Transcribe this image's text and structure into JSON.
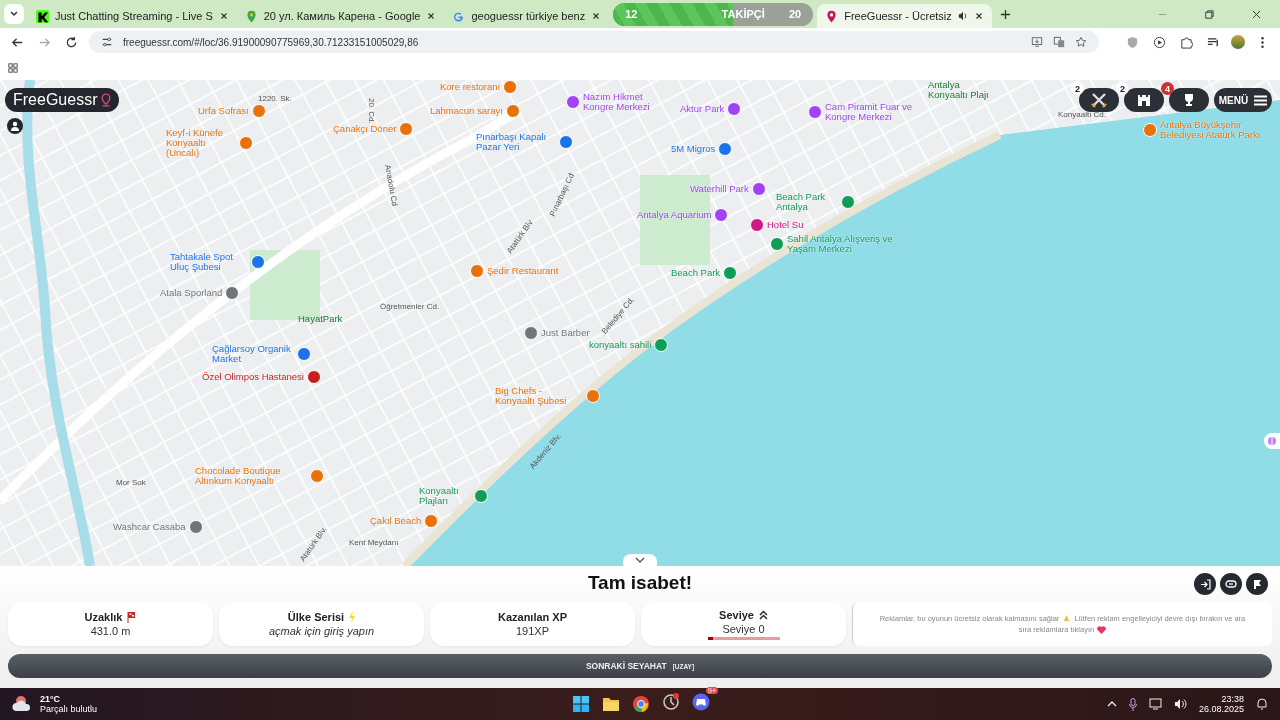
{
  "browser": {
    "tabs": [
      {
        "title": "Just Chatting Streaming - Live S",
        "selected": false
      },
      {
        "title": "20 ул. Камиль Карена - Google",
        "selected": false
      },
      {
        "title": "geoguessr türkiye benz",
        "selected": false
      },
      {
        "title": "FreeGuessr - Ücretsiz",
        "selected": true
      }
    ],
    "follower_goal": {
      "current": "12",
      "label": "TAKİPÇİ",
      "target": "20",
      "level": 0.6
    },
    "url": "freeguessr.com/#/loc/36.91900090775969,30.71233151005029,86"
  },
  "map": {
    "logo": "FreeGuessr",
    "buttons": [
      {
        "badge": "2",
        "color": "#ffffff"
      },
      {
        "badge": "2",
        "color": "#ffffff"
      },
      {
        "badge": "4",
        "color": "#d32f2f"
      }
    ],
    "menu_button": "MENÜ",
    "labels": [
      {
        "kind": "poi",
        "text": "Kore restoranı",
        "color": "#e8710a"
      },
      {
        "kind": "area",
        "text": "Antalya Konyaaltı Plajı"
      },
      {
        "kind": "poi",
        "text": "Urfa Sofrası",
        "color": "#e8710a"
      },
      {
        "kind": "street",
        "text": "1220. Sk."
      },
      {
        "kind": "street",
        "text": "20. Cd."
      },
      {
        "kind": "poi",
        "text": "Lahmacun sarayı",
        "color": "#e8710a"
      },
      {
        "kind": "poi",
        "text": "Nazım Hikmet Kongre Merkezi",
        "color": "#a142f4"
      },
      {
        "kind": "poi",
        "text": "Aktur Park",
        "color": "#a142f4"
      },
      {
        "kind": "poi",
        "text": "Cam Piramit Fuar ve Kongre Merkezi",
        "color": "#a142f4"
      },
      {
        "kind": "street",
        "text": "Konyaaltı Cd."
      },
      {
        "kind": "poi",
        "text": "Keyf-i Künefe Konyaaltı (Uncalı)",
        "color": "#e8710a"
      },
      {
        "kind": "poi",
        "text": "Çanakçı Döner",
        "color": "#e8710a"
      },
      {
        "kind": "poi",
        "text": "Pınarbaşı Kapalı Pazar Yeri",
        "color": "#1a73e8"
      },
      {
        "kind": "poi",
        "text": "5M Migros",
        "color": "#1a73e8"
      },
      {
        "kind": "poi",
        "text": "Antalya Büyükşehir Belediyesi Atatürk Parkı",
        "color": "#e8710a"
      },
      {
        "kind": "street",
        "text": "Anadolu Cd"
      },
      {
        "kind": "poi",
        "text": "Waterhill Park",
        "color": "#a142f4"
      },
      {
        "kind": "poi",
        "text": "Beach Park Antalya",
        "color": "#0f9d58"
      },
      {
        "kind": "street",
        "text": "Pınarbaşı Cd"
      },
      {
        "kind": "poi",
        "text": "Antalya Aquarium",
        "color": "#a142f4"
      },
      {
        "kind": "poi",
        "text": "Hotel Su",
        "color": "#d01884"
      },
      {
        "kind": "poi",
        "text": "Sahil Antalya Alışveriş ve Yaşam Merkezi",
        "color": "#0f9d58"
      },
      {
        "kind": "street",
        "text": "Atatürk Blv"
      },
      {
        "kind": "poi",
        "text": "Tahtakale Spot Uluç Şubesi",
        "color": "#1a73e8"
      },
      {
        "kind": "poi",
        "text": "Şedir Restaurant",
        "color": "#e8710a"
      },
      {
        "kind": "poi",
        "text": "Beach Park",
        "color": "#0f9d58"
      },
      {
        "kind": "poi",
        "text": "Atala Sporland",
        "color": "#70757a"
      },
      {
        "kind": "street",
        "text": "Öğretmenler Cd."
      },
      {
        "kind": "street",
        "text": "Belediye Cd."
      },
      {
        "kind": "area",
        "text": "HayatPark"
      },
      {
        "kind": "poi",
        "text": "Just Barber",
        "color": "#70757a"
      },
      {
        "kind": "poi",
        "text": "konyaaltı sahili",
        "color": "#0f9d58"
      },
      {
        "kind": "poi",
        "text": "Çağlarsoy Organik Market",
        "color": "#1a73e8"
      },
      {
        "kind": "poi",
        "text": "Özel Olimpos Hastanesi",
        "color": "#c5221f"
      },
      {
        "kind": "poi",
        "text": "Big Chefs - Konyaaltı Şubesi",
        "color": "#e8710a"
      },
      {
        "kind": "street",
        "text": "Akdeniz Blv."
      },
      {
        "kind": "street",
        "text": "Mor Sok"
      },
      {
        "kind": "poi",
        "text": "Chocolade Boutique Altınkum Konyaaltı",
        "color": "#e8710a"
      },
      {
        "kind": "poi",
        "text": "Konyaaltı Plajları",
        "color": "#0f9d58"
      },
      {
        "kind": "poi",
        "text": "Washcar Casaba",
        "color": "#70757a"
      },
      {
        "kind": "street",
        "text": "Atatürk Blv."
      },
      {
        "kind": "poi",
        "text": "Çakıl Beach",
        "color": "#e8710a"
      },
      {
        "kind": "street",
        "text": "Kent Meydanı"
      }
    ]
  },
  "result": {
    "title": "Tam isabet!",
    "stats": [
      {
        "kind": "distance",
        "label": "Uzaklık",
        "value": "431.0 m"
      },
      {
        "kind": "streak",
        "label": "Ülke Serisi",
        "value": "açmak için giriş yapın"
      },
      {
        "kind": "xp",
        "label": "Kazanılan XP",
        "value": "191XP"
      },
      {
        "kind": "level",
        "label": "Seviye",
        "value": "Seviye 0",
        "level": 0.08
      }
    ],
    "ad": {
      "text_1": "Reklamlar, bu oyunun ücretsiz olarak kalmasını sağlar",
      "text_2": "Lütfen reklam engelleyiciyi devre dışı bırakın ve ara",
      "text_3": "sıra reklamlara tıklayın"
    },
    "next_button": "SONRAKİ SEYAHAT",
    "next_key": "[UZAY]"
  },
  "taskbar": {
    "temperature": "21°C",
    "weather": "Parçalı bulutlu",
    "discord_badge": "9+",
    "time": "23:38",
    "date": "26.08.2025"
  }
}
